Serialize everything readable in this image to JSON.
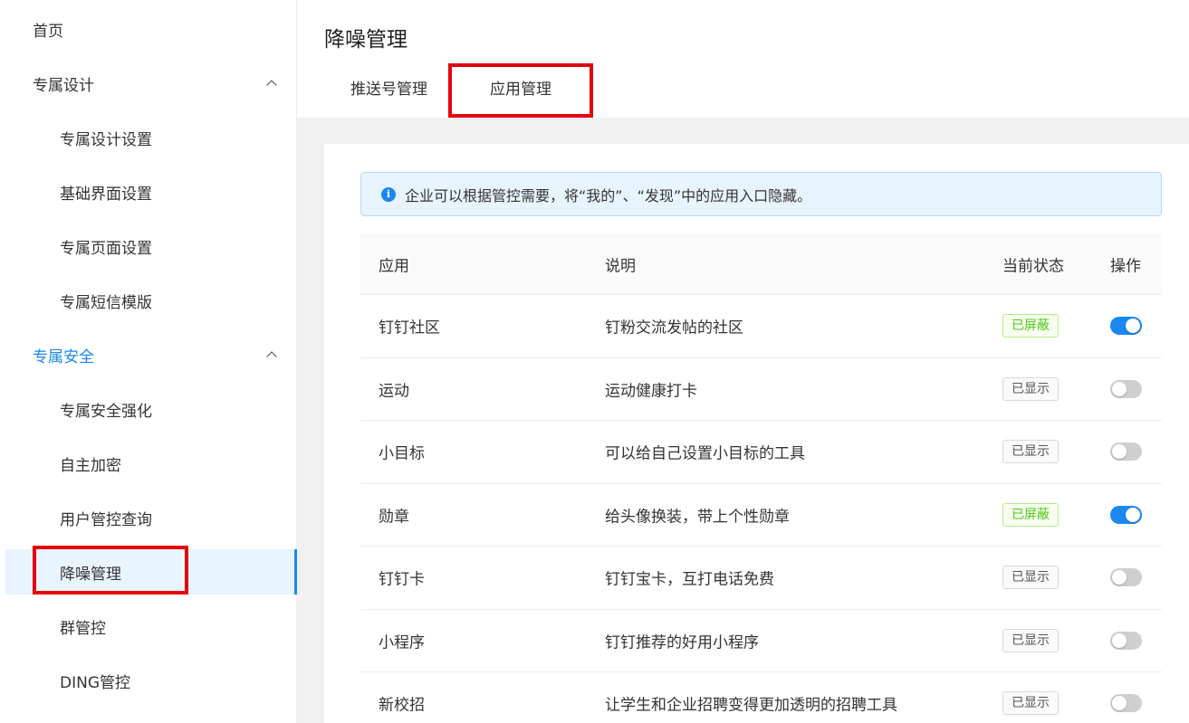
{
  "page": {
    "title": "降噪管理",
    "info_text": "企业可以根据管控需要，将“我的”、“发现”中的应用入口隐藏。"
  },
  "sidebar": {
    "items": [
      {
        "label": "首页",
        "level": 1
      },
      {
        "label": "专属设计",
        "level": 1,
        "expanded": true
      },
      {
        "label": "专属设计设置",
        "level": 2
      },
      {
        "label": "基础界面设置",
        "level": 2
      },
      {
        "label": "专属页面设置",
        "level": 2
      },
      {
        "label": "专属短信模版",
        "level": 2
      },
      {
        "label": "专属安全",
        "level": 1,
        "expanded": true
      },
      {
        "label": "专属安全强化",
        "level": 2
      },
      {
        "label": "自主加密",
        "level": 2
      },
      {
        "label": "用户管控查询",
        "level": 2
      },
      {
        "label": "降噪管理",
        "level": 2,
        "active": true
      },
      {
        "label": "群管控",
        "level": 2
      },
      {
        "label": "DING管控",
        "level": 2
      }
    ]
  },
  "tabs": [
    {
      "label": "推送号管理",
      "active": false
    },
    {
      "label": "应用管理",
      "active": true
    }
  ],
  "table": {
    "headers": {
      "app": "应用",
      "desc": "说明",
      "status": "当前状态",
      "op": "操作"
    },
    "rows": [
      {
        "app": "钉钉社区",
        "desc": "钉粉交流发帖的社区",
        "status": "已屏蔽",
        "on": true
      },
      {
        "app": "运动",
        "desc": "运动健康打卡",
        "status": "已显示",
        "on": false
      },
      {
        "app": "小目标",
        "desc": "可以给自己设置小目标的工具",
        "status": "已显示",
        "on": false
      },
      {
        "app": "勋章",
        "desc": "给头像换装，带上个性勋章",
        "status": "已屏蔽",
        "on": true
      },
      {
        "app": "钉钉卡",
        "desc": "钉钉宝卡，互打电话免费",
        "status": "已显示",
        "on": false
      },
      {
        "app": "小程序",
        "desc": "钉钉推荐的好用小程序",
        "status": "已显示",
        "on": false
      },
      {
        "app": "新校招",
        "desc": "让学生和企业招聘变得更加透明的招聘工具",
        "status": "已显示",
        "on": false
      }
    ]
  },
  "colors": {
    "accent": "#1a88f0",
    "highlight_red": "#e6000e",
    "hidden_green": "#52c41a"
  }
}
